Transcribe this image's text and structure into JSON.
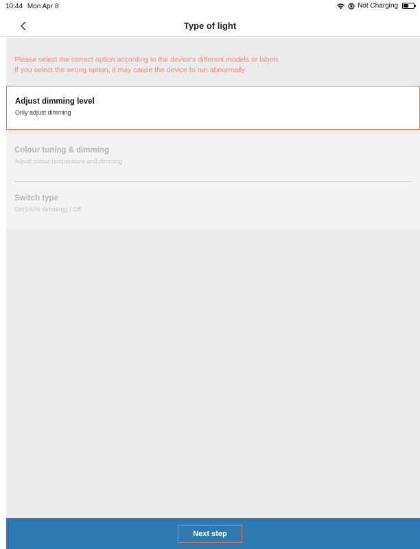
{
  "status_bar": {
    "time": "10:44",
    "date": "Mon Apr 8",
    "charging": "Not Charging",
    "icons": [
      "wifi-icon",
      "orientation-lock-icon",
      "battery-icon"
    ]
  },
  "nav": {
    "title": "Type of light",
    "back_icon": "chevron-left-icon"
  },
  "warning": {
    "line1": "Please select the correct option according to the device's different models or labels",
    "line2": "If you select the wrong option, it may cause the device to run abnormally",
    "color": "#f08b77"
  },
  "options": [
    {
      "title": "Adjust dimming level",
      "subtitle": "Only adjust dimming",
      "selected": true
    },
    {
      "title": "Colour tuning & dimming",
      "subtitle": "Adjust colour temperature and dimming",
      "selected": false
    },
    {
      "title": "Switch type",
      "subtitle": "On(100% dimming) / Off",
      "selected": false
    }
  ],
  "footer": {
    "next_label": "Next step",
    "bar_color": "#2d7ab3",
    "highlight_color": "#e86e4a"
  }
}
